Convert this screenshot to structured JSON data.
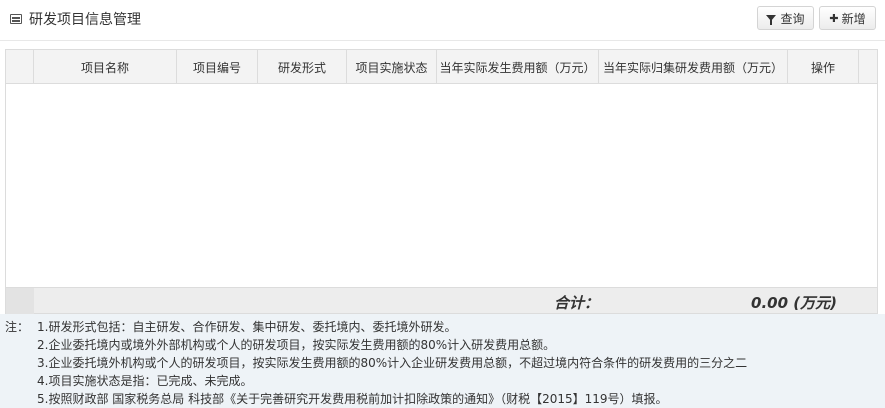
{
  "header": {
    "title": "研发项目信息管理",
    "query_label": "查询",
    "add_label": "新增"
  },
  "table": {
    "columns": [
      "项目名称",
      "项目编号",
      "研发形式",
      "项目实施状态",
      "当年实际发生费用额（万元）",
      "当年实际归集研发费用额（万元）",
      "操作"
    ],
    "rows": []
  },
  "footer": {
    "total_label": "合计：",
    "total_value": "0.00 (万元)"
  },
  "notes": {
    "prefix": "注：",
    "lines": [
      "1.研发形式包括：自主研发、合作研发、集中研发、委托境内、委托境外研发。",
      "2.企业委托境内或境外外部机构或个人的研发项目，按实际发生费用额的80%计入研发费用总额。",
      "3.企业委托境外机构或个人的研发项目，按实际发生费用额的80%计入企业研发费用总额，不超过境内符合条件的研发费用的三分之二",
      "4.项目实施状态是指：已完成、未完成。",
      "5.按照财政部 国家税务总局 科技部《关于完善研究开发费用税前加计扣除政策的通知》（财税【2015】119号）填报。"
    ]
  },
  "colors": {
    "header_bg": "#f3f3f3",
    "notes_bg": "#eef3f7",
    "border": "#dcdcdc"
  }
}
